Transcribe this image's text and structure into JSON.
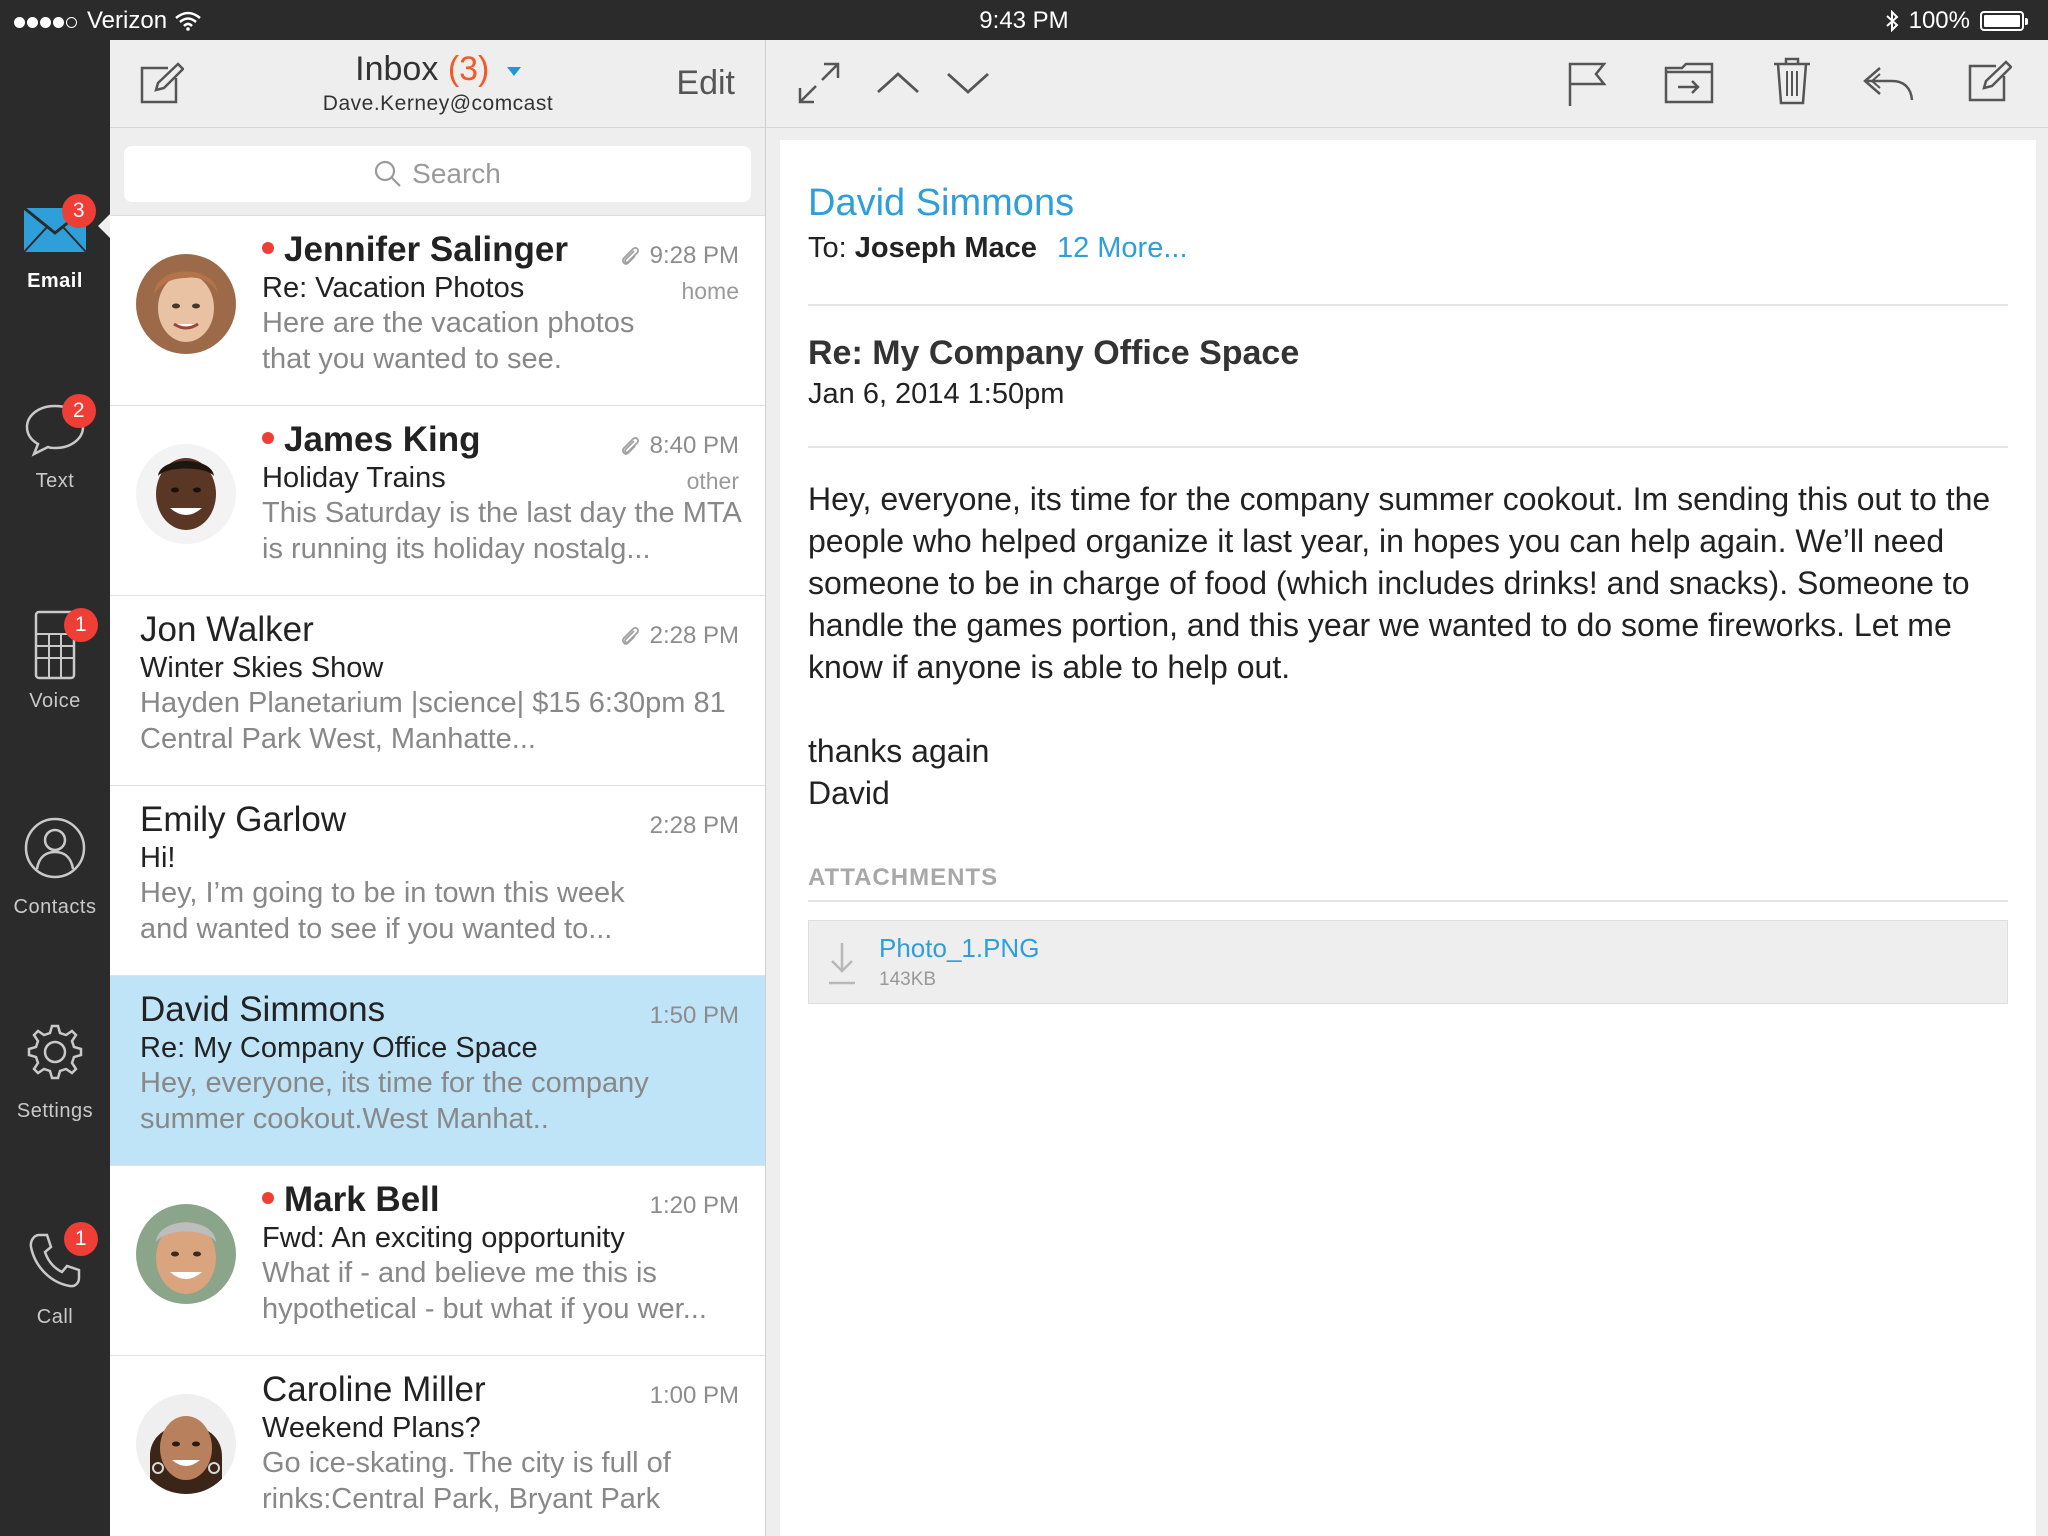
{
  "status_bar": {
    "carrier": "Verizon",
    "time": "9:43 PM",
    "battery": "100%"
  },
  "nav": {
    "items": [
      {
        "label": "Email",
        "badge": "3",
        "icon": "envelope-icon"
      },
      {
        "label": "Text",
        "badge": "2",
        "icon": "speech-bubble-icon"
      },
      {
        "label": "Voice",
        "badge": "1",
        "icon": "keypad-icon"
      },
      {
        "label": "Contacts",
        "badge": "",
        "icon": "person-icon"
      },
      {
        "label": "Settings",
        "badge": "",
        "icon": "gear-icon"
      },
      {
        "label": "Call",
        "badge": "1",
        "icon": "phone-icon"
      }
    ]
  },
  "inbox": {
    "title": "Inbox",
    "count": "(3)",
    "account": "Dave.Kerney@comcast",
    "edit_label": "Edit",
    "search_placeholder": "Search"
  },
  "messages": [
    {
      "sender": "Jennifer Salinger",
      "subject": "Re: Vacation Photos",
      "preview": "Here are the vacation photos that you wanted to see.",
      "time": "9:28 PM",
      "folder": "home",
      "unread": true,
      "attachment": true
    },
    {
      "sender": "James King",
      "subject": "Holiday Trains",
      "preview": "This Saturday is the last day the MTA is running its holiday nostalg...",
      "time": "8:40 PM",
      "folder": "other",
      "unread": true,
      "attachment": true
    },
    {
      "sender": "Jon Walker",
      "subject": "Winter Skies Show",
      "preview": "Hayden Planetarium |science| $15 6:30pm 81 Central Park West, Manhatte...",
      "time": "2:28 PM",
      "folder": "",
      "unread": false,
      "attachment": true
    },
    {
      "sender": "Emily Garlow",
      "subject": "Hi!",
      "preview": "Hey, I’m going to be in town this week and wanted to see if you wanted to...",
      "time": "2:28 PM",
      "folder": "",
      "unread": false,
      "attachment": false
    },
    {
      "sender": "David Simmons",
      "subject": "Re: My Company Office Space",
      "preview": "Hey, everyone, its time for the company summer cookout.West Manhat..",
      "time": "1:50 PM",
      "folder": "",
      "unread": false,
      "attachment": false
    },
    {
      "sender": "Mark Bell",
      "subject": "Fwd: An exciting opportunity",
      "preview": "What if - and believe me this is hypothetical - but what if you wer...",
      "time": "1:20 PM",
      "folder": "",
      "unread": true,
      "attachment": false
    },
    {
      "sender": "Caroline Miller",
      "subject": "Weekend Plans?",
      "preview": "Go ice-skating. The city is full of rinks:Central Park, Bryant Park",
      "time": "1:00 PM",
      "folder": "",
      "unread": false,
      "attachment": false
    }
  ],
  "detail": {
    "from": "David Simmons",
    "to_label": "To:",
    "to_name": "Joseph Mace",
    "to_more": "12 More...",
    "subject": "Re: My Company Office Space",
    "date": "Jan 6, 2014 1:50pm",
    "body_1": "Hey, everyone, its time for the company summer cookout. Im sending this out to the people who helped organize it last year, in hopes you can help again. We’ll need someone to be in charge of food (which includes drinks! and snacks). Someone to handle the games portion, and this year we wanted to do some fireworks. Let me know if anyone is able to help out.",
    "body_2": "thanks again",
    "body_3": "David",
    "attachments_label": "ATTACHMENTS",
    "attachment_name": "Photo_1.PNG",
    "attachment_size": "143KB"
  },
  "colors": {
    "accent": "#2e9fd9",
    "badge": "#ef3e36",
    "selected_row": "#bfe3f7",
    "sidebar": "#2b2b2b"
  }
}
